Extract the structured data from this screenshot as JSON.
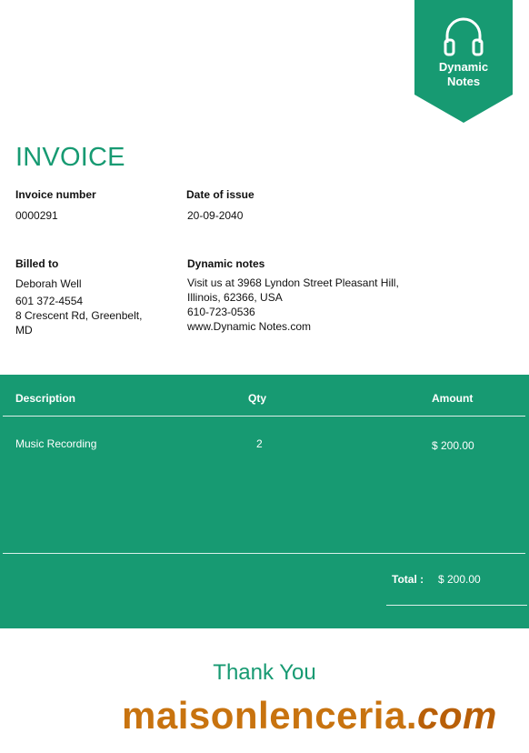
{
  "brand": {
    "line1": "Dynamic",
    "line2": "Notes",
    "icon": "headphones-icon"
  },
  "invoice": {
    "title": "INVOICE",
    "number_label": "Invoice number",
    "number": "0000291",
    "date_label": "Date of issue",
    "date": "20-09-2040"
  },
  "billed_to": {
    "label": "Billed to",
    "name": "Deborah Well",
    "phone": "601 372-4554",
    "address_line1": "8 Crescent Rd, Greenbelt,",
    "address_line2": "MD"
  },
  "company": {
    "label": "Dynamic notes",
    "address_line1": "Visit us at 3968 Lyndon Street Pleasant Hill,",
    "address_line2": "Illinois, 62366, USA",
    "phone": "610-723-0536",
    "website": "www.Dynamic Notes.com"
  },
  "table": {
    "headers": {
      "description": "Description",
      "qty": "Qty",
      "amount": "Amount"
    },
    "rows": [
      {
        "description": "Music Recording",
        "qty": "2",
        "amount": "$ 200.00"
      }
    ],
    "total_label": "Total :",
    "total_value": "$ 200.00"
  },
  "footer": {
    "thank_you": "Thank You",
    "watermark_main": "maisonlenceria.",
    "watermark_tld": "com"
  },
  "colors": {
    "accent": "#179a72",
    "watermark": "#c8730f"
  }
}
